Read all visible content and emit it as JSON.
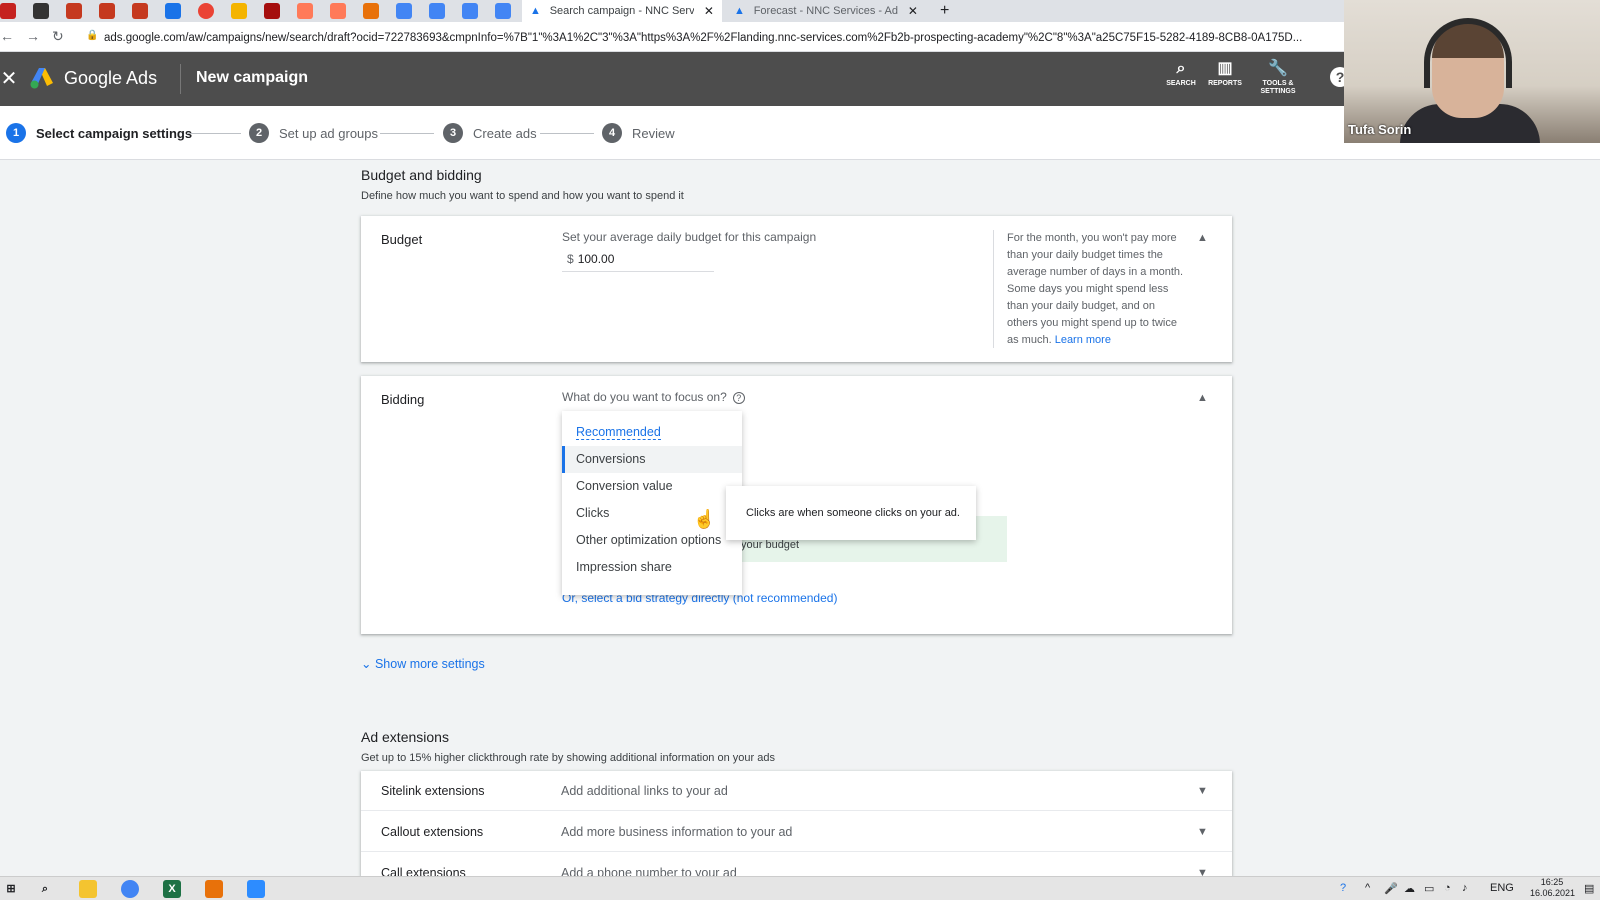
{
  "browser": {
    "tabs": [
      {
        "title": "Search campaign - NNC Services",
        "active": true
      },
      {
        "title": "Forecast - NNC Services - Ads W",
        "active": false
      }
    ],
    "new_tab": "+",
    "url": "ads.google.com/aw/campaigns/new/search/draft?ocid=722783693&cmpnInfo=%7B\"1\"%3A1%2C\"3\"%3A\"https%3A%2F%2Flanding.nnc-services.com%2Fb2b-prospecting-academy\"%2C\"8\"%3A\"a25C75F15-5282-4189-8CB8-0A175D...",
    "close_glyph": "✕"
  },
  "ads_header": {
    "close": "✕",
    "product": "Google Ads",
    "campaign_title": "New campaign",
    "icons": [
      {
        "label": "SEARCH",
        "glyph": "⌕"
      },
      {
        "label": "REPORTS",
        "glyph": "▥"
      },
      {
        "label": "TOOLS & SETTINGS",
        "glyph": "🔧"
      }
    ],
    "help": "?"
  },
  "stepper": {
    "steps": [
      {
        "num": "1",
        "label": "Select campaign settings"
      },
      {
        "num": "2",
        "label": "Set up ad groups"
      },
      {
        "num": "3",
        "label": "Create ads"
      },
      {
        "num": "4",
        "label": "Review"
      }
    ]
  },
  "webcam": {
    "name": "Tufa Sorin"
  },
  "budget_section": {
    "title": "Budget and bidding",
    "subtitle": "Define how much you want to spend and how you want to spend it",
    "budget_label": "Budget",
    "budget_prompt": "Set your average daily budget for this campaign",
    "currency": "$",
    "budget_value": "100.00",
    "info_text": "For the month, you won't pay more than your daily budget times the average number of days in a month. Some days you might spend less than your daily budget, and on others you might spend up to twice as much.",
    "learn_more": "Learn more"
  },
  "bidding": {
    "label": "Bidding",
    "question": "What do you want to focus on?",
    "help_glyph": "?",
    "options": [
      "Recommended",
      "Conversions",
      "Conversion value",
      "Clicks",
      "Other optimization options",
      "Impression share"
    ],
    "selected": "Conversions",
    "tooltip": "Clicks are when someone clicks on your ad.",
    "partial_text": "your budget",
    "bid_link": "Or, select a bid strategy directly (not recommended)"
  },
  "show_more": "Show more settings",
  "extensions": {
    "title": "Ad extensions",
    "subtitle": "Get up to 15% higher clickthrough rate by showing additional information on your ads",
    "rows": [
      {
        "name": "Sitelink extensions",
        "desc": "Add additional links to your ad"
      },
      {
        "name": "Callout extensions",
        "desc": "Add more business information to your ad"
      },
      {
        "name": "Call extensions",
        "desc": "Add a phone number to your ad"
      }
    ]
  },
  "taskbar": {
    "lang": "ENG",
    "time": "16:25",
    "date": "16.06.2021"
  },
  "colors": {
    "accent": "#1a73e8",
    "header": "#4d4d4d"
  }
}
